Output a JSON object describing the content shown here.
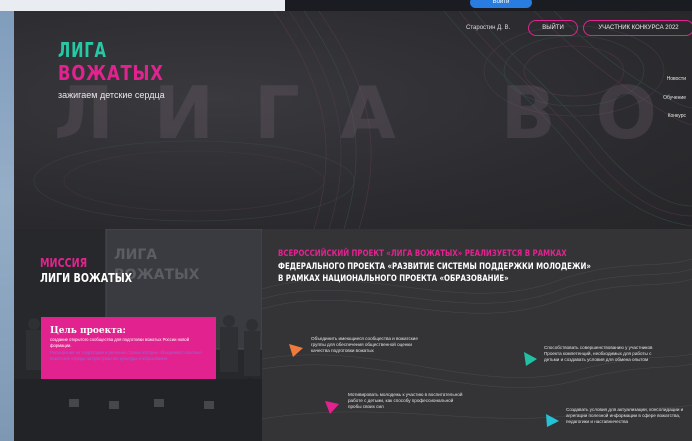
{
  "header": {
    "logo_line1": "ЛИГА",
    "logo_line2": "ВОЖАТЫХ",
    "tagline": "зажигаем детские сердца",
    "background_word": "ЛИГА ВОЖАТЫХ",
    "user_name": "Старостин Д. В.",
    "exit_label": "ВЫЙТИ",
    "participant_label": "УЧАСТНИК КОНКУРСА 2022"
  },
  "nav": {
    "items": [
      "Новости",
      "Обучение",
      "Конкурс"
    ]
  },
  "background_strip": {
    "button_label": "Войти"
  },
  "mission": {
    "title_line1": "МИССИЯ",
    "title_line2": "ЛИГИ ВОЖАТЫХ",
    "goal_title": "Цель проекта:",
    "goal_text": "создание открытого сообщества для подготовки вожатых России новой формации.",
    "goal_text_faded": "Расширение на территории и регионах страны которые объединяют опытные вожатские отряды на пространстве культуры и образования."
  },
  "project": {
    "heading_pink": "ВСЕРОССИЙСКИЙ ПРОЕКТ «ЛИГА ВОЖАТЫХ» РЕАЛИЗУЕТСЯ В РАМКАХ",
    "heading_white1": "ФЕДЕРАЛЬНОГО ПРОЕКТА «РАЗВИТИЕ СИСТЕМЫ ПОДДЕРЖКИ МОЛОДЕЖИ»",
    "heading_white2": "В РАМКАХ НАЦИОНАЛЬНОГО ПРОЕКТА «ОБРАЗОВАНИЕ»",
    "items": [
      {
        "text": "Объединить имеющиеся сообщества и вожатские группы для обеспечения общественной оценки качества подготовки вожатых",
        "icon": "orange-triangle-icon"
      },
      {
        "text": "Способствовать совершенствованию у участников Проекта компетенций, необходимых для работы с детьми и создавать условия для обмена опытом",
        "icon": "teal-triangle-icon"
      },
      {
        "text": "Мотивировать молодежь к участию в воспитательной работе с детьми, как способу профессиональной пробы своих сил",
        "icon": "pink-triangle-icon"
      },
      {
        "text": "Создавать условия для актуализации, консолидации и агрегации полезной информации в сфере вожатства, педагогики и наставничества",
        "icon": "cyan-triangle-icon"
      }
    ]
  },
  "colors": {
    "accent_pink": "#e2238f",
    "accent_teal": "#26c9a5",
    "bg_dark": "#2b2b2e"
  }
}
